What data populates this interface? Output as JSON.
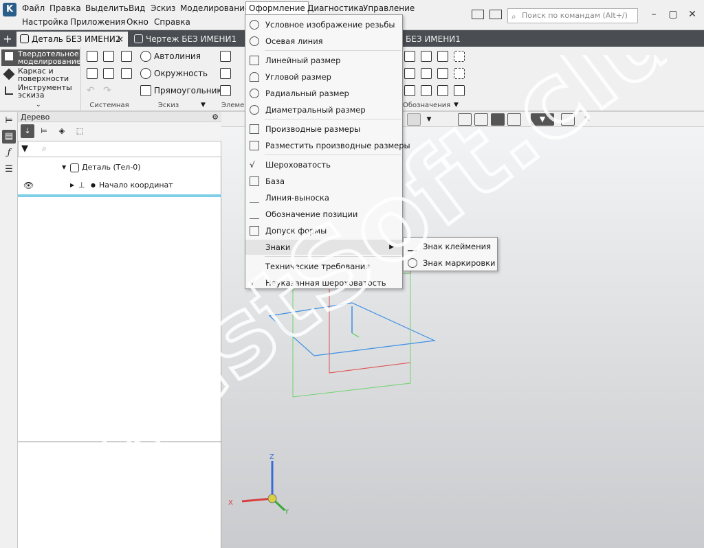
{
  "menubar": {
    "row1": [
      "Файл",
      "Правка",
      "Выделить",
      "Вид",
      "Эскиз",
      "Моделирование",
      "Оформление",
      "Диагностика",
      "Управление"
    ],
    "row2": [
      "Настройка",
      "Приложения",
      "Окно",
      "Справка"
    ],
    "search_placeholder": "Поиск по командам (Alt+/)",
    "active_menu": "Оформление"
  },
  "tabs": [
    {
      "label": "Деталь БЕЗ ИМЕНИ2",
      "active": true,
      "close": "×"
    },
    {
      "label": "Чертеж БЕЗ ИМЕНИ1",
      "active": false
    },
    {
      "label": "БЕЗ ИМЕНИ1",
      "active": false
    }
  ],
  "ribbon": {
    "modes": [
      "Твердотельное моделирование",
      "Каркас и поверхности",
      "Инструменты эскиза"
    ],
    "tools": [
      "Автолиния",
      "Окружность",
      "Прямоугольник"
    ],
    "groups": [
      "Системная",
      "Эскиз",
      "Элемен",
      "Обозначения"
    ]
  },
  "tree": {
    "title": "Дерево",
    "rows": [
      "Деталь (Тел-0)",
      "Начало координат"
    ]
  },
  "dropdown": {
    "items": [
      "Условное изображение резьбы",
      "Осевая линия",
      "Линейный размер",
      "Угловой размер",
      "Радиальный размер",
      "Диаметральный размер",
      "Производные размеры",
      "Разместить производные размеры",
      "Шероховатость",
      "База",
      "Линия-выноска",
      "Обозначение позиции",
      "Допуск формы",
      "Знаки",
      "Технические требования",
      "Неуказанная шероховатость"
    ],
    "submenu": [
      "Знак клеймения",
      "Знак маркировки"
    ]
  },
  "axes": {
    "z": "Z",
    "x": "X",
    "y": "Y"
  },
  "watermark": "BestSoft.club"
}
